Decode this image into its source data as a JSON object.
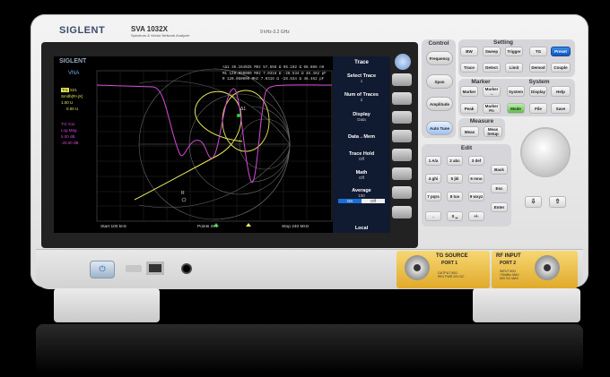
{
  "brand": {
    "logo": "SIGLENT",
    "model": "SVA 1032X",
    "model_sub": "Spectrum & Vector Network Analyzer",
    "freq_range": "9 kHz-3.2 GHz"
  },
  "screen": {
    "logo": "SIGLENT",
    "mode": "VNA",
    "left_panel": {
      "tr1": "Tr1",
      "s21": "S21",
      "format1": "Smith(R+jX)",
      "scale1": "1.00 U",
      "ref1": "0.00 U",
      "tr2": "Tr2 S11",
      "format2": "Log Mag",
      "scale2": "5.00 dB",
      "ref2": "-20.00 dB"
    },
    "markers": [
      {
        "id": "×Δ1",
        "freq": "36.164925 MHz",
        "r": "57.556 Ω",
        "x": "96.102 Ω",
        "val": "68.886 nH"
      },
      {
        "id": "M1",
        "freq": "120.050000 MHz",
        "r": "7.0316 Ω",
        "x": "-28.534 Ω",
        "val": "46.462 pF"
      },
      {
        "id": "R",
        "freq": "120.050000 MHz",
        "r": "7.0316 Ω",
        "x": "-28.534 Ω",
        "val": "46.462 pF"
      }
    ],
    "marker_labels": {
      "delta": "Δ1",
      "ref": "R"
    },
    "footer": {
      "start": "Start 100 kHz",
      "points": "Points  201",
      "stop": "Stop  240 MHz"
    },
    "menu": {
      "title": "Trace",
      "items": [
        {
          "label": "Select Trace",
          "value": "1"
        },
        {
          "label": "Num of Traces",
          "value": "2"
        },
        {
          "label": "Display",
          "value": "Data"
        },
        {
          "label": "Data→Mem",
          "value": ""
        },
        {
          "label": "Trace Hold",
          "value": "Off"
        },
        {
          "label": "Math",
          "value": "Off"
        },
        {
          "label": "Average",
          "value": "100"
        }
      ],
      "avg_on": "On",
      "avg_off": "Off",
      "bottom": "Local"
    }
  },
  "panel": {
    "control_title": "Control",
    "setting_title": "Setting",
    "marker_title": "Marker",
    "system_title": "System",
    "measure_title": "Measure",
    "edit_title": "Edit",
    "control_buttons": [
      "Frequency",
      "Span",
      "Amplitude",
      "Auto Tune"
    ],
    "setting_row1": [
      "BW",
      "Sweep",
      "Trigger",
      "TG"
    ],
    "preset": "Preset",
    "setting_row2": [
      "Trace",
      "Detect",
      "Limit",
      "Demod",
      "Couple"
    ],
    "marker_row1": [
      "Marker",
      "Marker\n→"
    ],
    "marker_row2": [
      "Peak",
      "Marker\nFn"
    ],
    "system_row1": [
      "System",
      "Display",
      "Help"
    ],
    "system_row2": [
      "Mode",
      "File",
      "Save"
    ],
    "measure_buttons": [
      "Meas",
      "Meas\nSetup"
    ],
    "keypad": [
      "1 A/a",
      "2 abc",
      "3 def",
      "4 ghi",
      "5 jkl",
      "6 mno",
      "7 pqrs",
      "8 tuv",
      "9 wxyz",
      ".",
      "0 ␣",
      "+/-"
    ],
    "edit_buttons": [
      "Back",
      "Esc",
      "Enter"
    ]
  },
  "ports": {
    "tg_title": "TG SOURCE",
    "tg_port": "PORT 1",
    "tg_note": "OUTPUT 50Ω\nREV PWR 20V DC",
    "rf_title": "RF INPUT",
    "rf_port": "PORT 2",
    "rf_note": "INPUT 50Ω\n+30dBm MAX\n50V DC MAX"
  },
  "colors": {
    "accent": "#1a6fd6",
    "trace1": "#e8e85a",
    "trace2": "#d34bd8",
    "menu_bg": "#101a30"
  }
}
